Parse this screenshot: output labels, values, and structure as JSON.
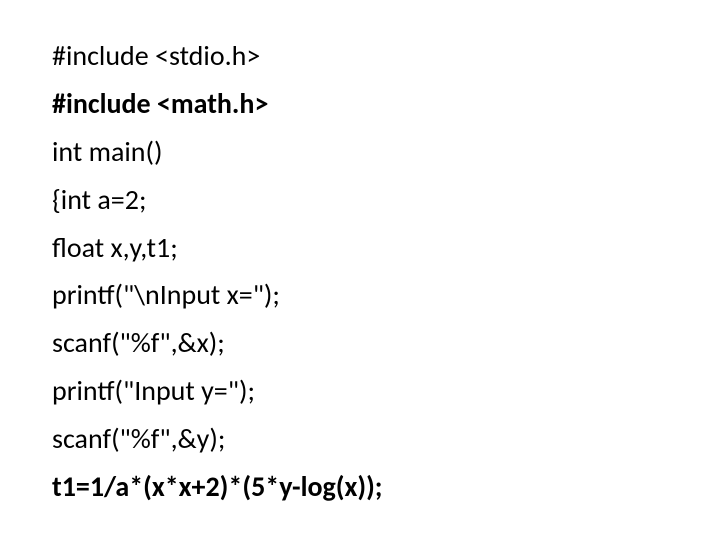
{
  "code": {
    "lines": [
      {
        "text": "#include <stdio.h>",
        "bold": false
      },
      {
        "text": "#include <math.h>",
        "bold": true
      },
      {
        "text": "int main()",
        "bold": false
      },
      {
        "text": "{int a=2;",
        "bold": false
      },
      {
        "text": "float x,y,t1;",
        "bold": false
      },
      {
        "text": "printf(\"\\nInput x=\");",
        "bold": false
      },
      {
        "text": "scanf(\"%f\",&x);",
        "bold": false
      },
      {
        "text": "printf(\"Input y=\");",
        "bold": false
      },
      {
        "text": "scanf(\"%f\",&y);",
        "bold": false
      },
      {
        "text": "t1=1/a*(x*x+2)*(5*y-log(x));",
        "bold": true
      }
    ]
  }
}
